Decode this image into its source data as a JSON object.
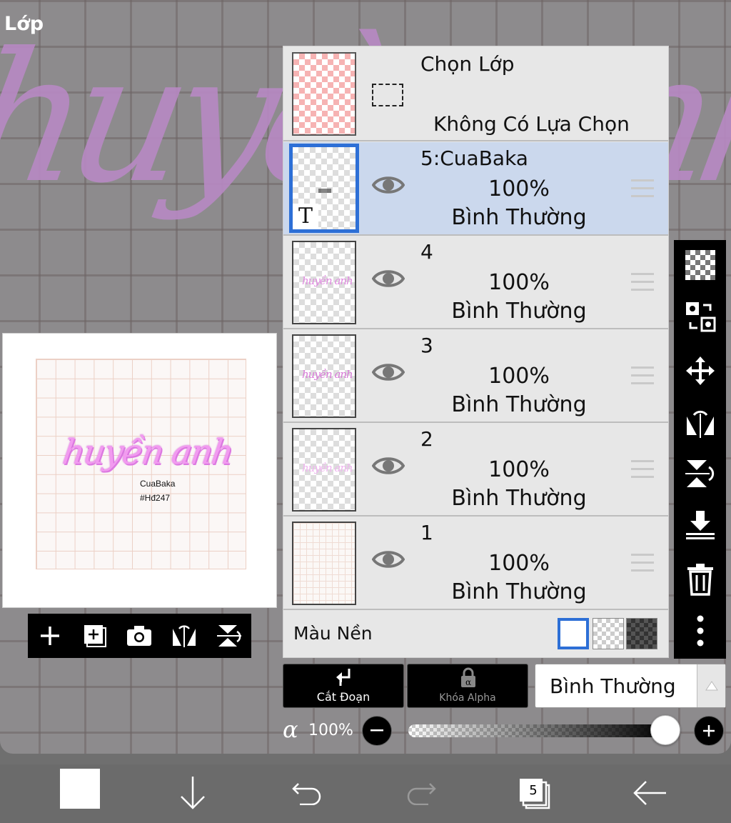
{
  "panel_title": "Lớp",
  "selection": {
    "title": "Chọn Lớp",
    "status": "Không Có Lựa Chọn"
  },
  "layers": [
    {
      "name": "5:CuaBaka",
      "opacity": "100%",
      "blend": "Bình Thường",
      "type_badge": "T",
      "active": true
    },
    {
      "name": "4",
      "opacity": "100%",
      "blend": "Bình Thường",
      "active": false
    },
    {
      "name": "3",
      "opacity": "100%",
      "blend": "Bình Thường",
      "active": false
    },
    {
      "name": "2",
      "opacity": "100%",
      "blend": "Bình Thường",
      "active": false
    },
    {
      "name": "1",
      "opacity": "100%",
      "blend": "Bình Thường",
      "active": false
    }
  ],
  "background": {
    "label": "Màu Nền",
    "selected": "white"
  },
  "preview": {
    "script": "huyền anh",
    "line1": "CuaBaka",
    "line2": "#Hđ247"
  },
  "controls": {
    "clip_label": "Cắt Đoạn",
    "alpha_lock_label": "Khóa Alpha",
    "blend_mode": "Bình Thường",
    "alpha_symbol": "α",
    "alpha_value": "100%",
    "alpha_fraction": 1.0
  },
  "bottom": {
    "layer_count": "5"
  },
  "colors": {
    "accent": "#2d6fd6",
    "active_row": "#cbd8ed",
    "panel": "#e7e7e7"
  }
}
